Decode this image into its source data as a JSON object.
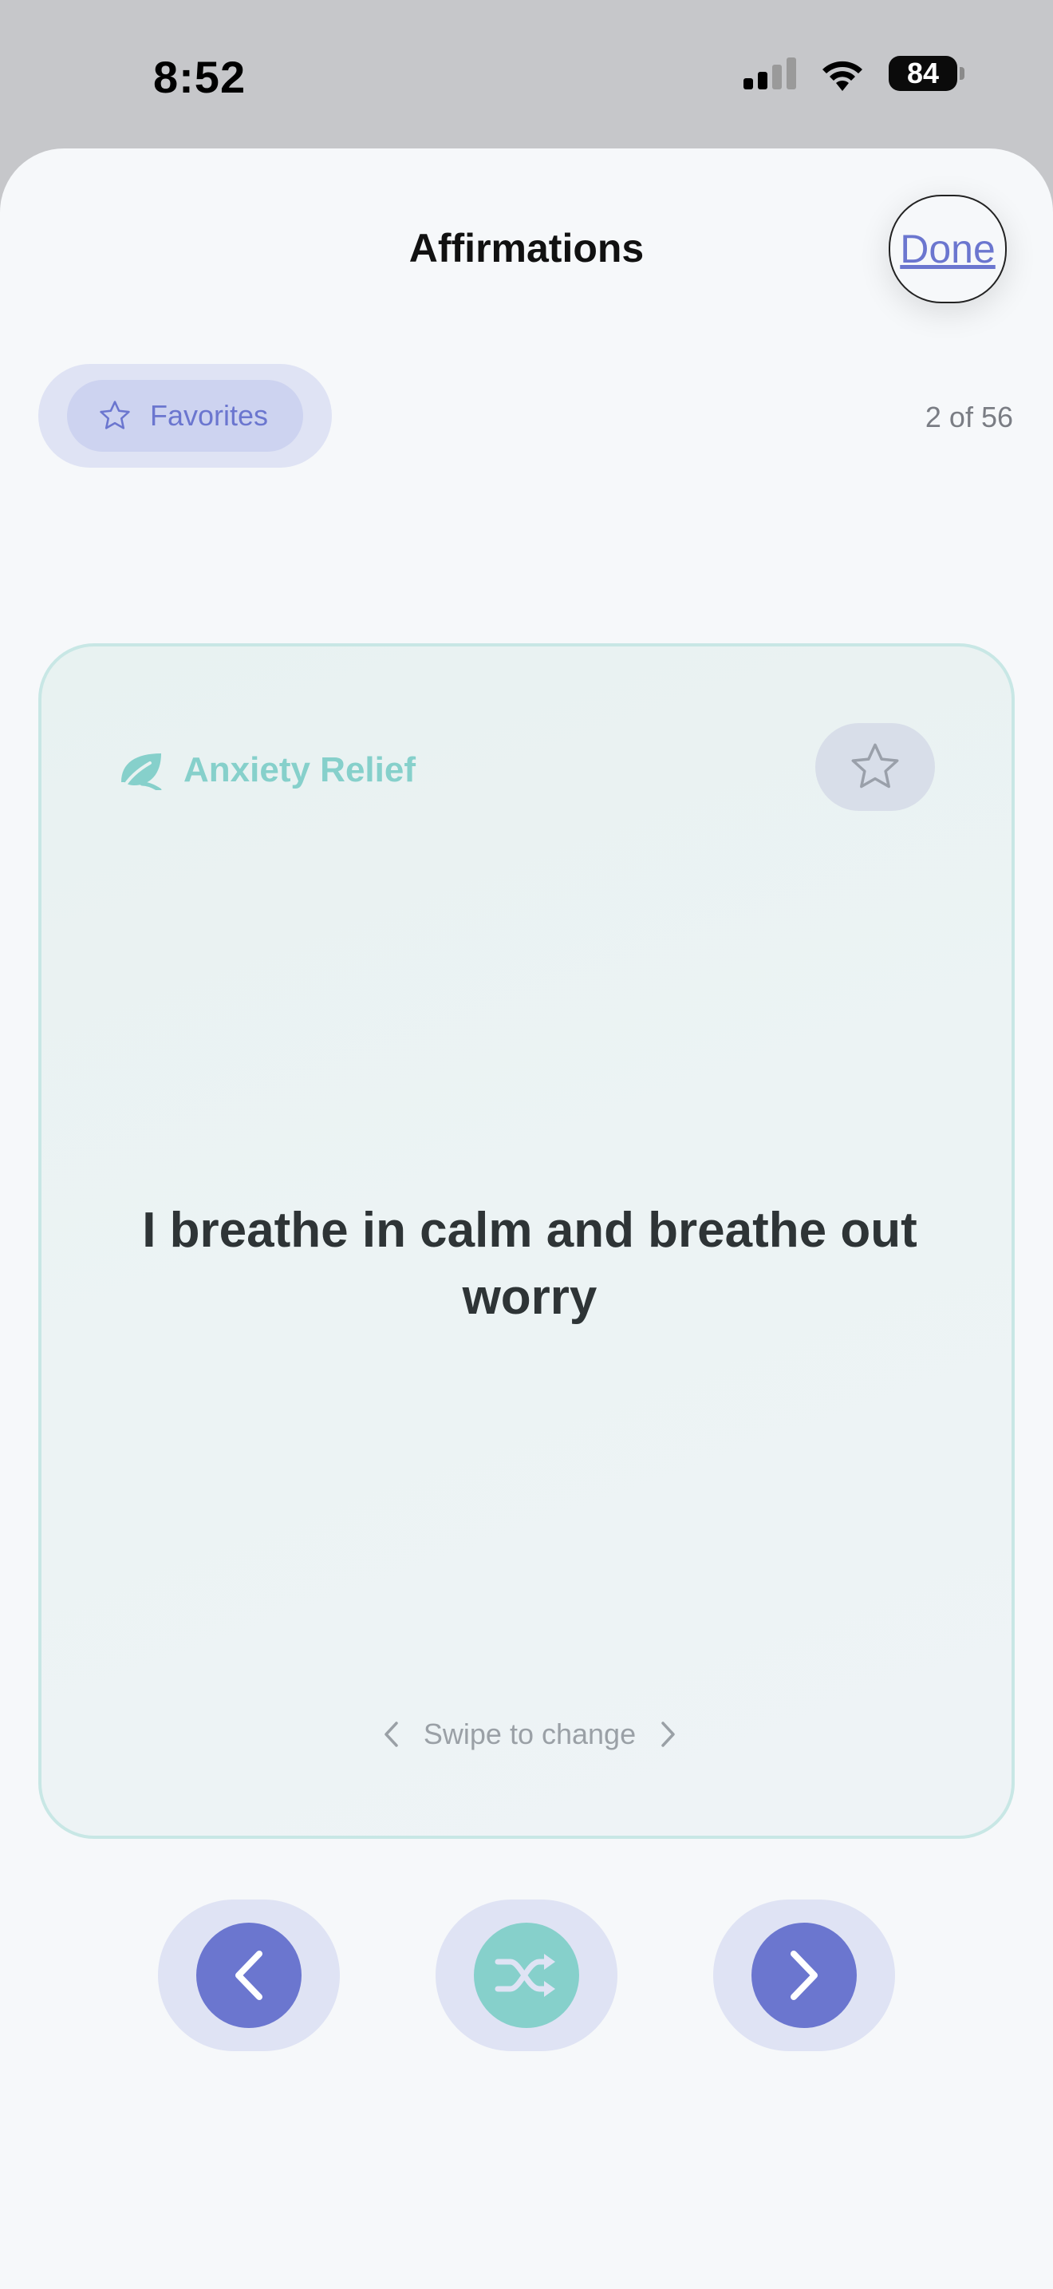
{
  "status_bar": {
    "time": "8:52",
    "battery_level": "84"
  },
  "header": {
    "title": "Affirmations",
    "done_label": "Done"
  },
  "filter": {
    "favorites_label": "Favorites",
    "counter": "2 of 56"
  },
  "card": {
    "category": "Anxiety Relief",
    "affirmation": "I breathe in calm and breathe out worry",
    "swipe_hint": "Swipe to change"
  },
  "controls": {
    "previous_icon": "chevron-left-icon",
    "shuffle_icon": "shuffle-icon",
    "next_icon": "chevron-right-icon"
  },
  "colors": {
    "accent": "#6b76cf",
    "teal": "#86d0cb",
    "card_border": "#c8e7e5",
    "pill_bg": "#dfe3f4"
  }
}
